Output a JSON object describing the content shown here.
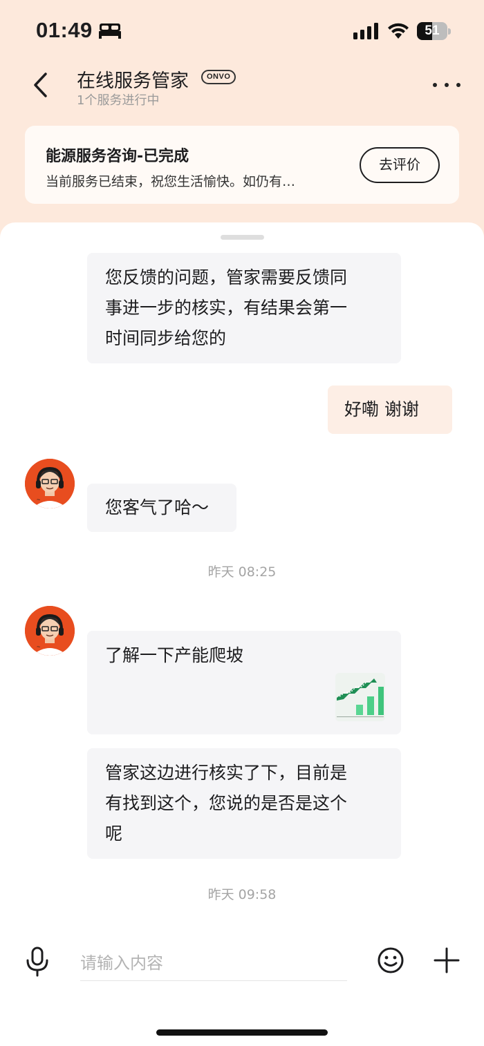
{
  "status_bar": {
    "time": "01:49",
    "battery_percent": "51",
    "battery_level": 0.51,
    "icons": [
      "bed-icon",
      "signal-icon",
      "wifi-icon",
      "battery-icon"
    ]
  },
  "header": {
    "title": "在线服务管家",
    "brand_badge": "ONVO",
    "subtitle": "1个服务进行中",
    "icons": [
      "chevron-left-icon",
      "more-icon"
    ]
  },
  "service_card": {
    "title": "能源服务咨询-已完成",
    "description": "当前服务已结束，祝您生活愉快。如仍有…",
    "review_button": "去评价"
  },
  "messages": {
    "m1": {
      "sender": "agent",
      "lines": [
        "您反馈的问题，管家需要反馈同",
        "事进一步的核实，有结果会第一",
        "时间同步给您的"
      ]
    },
    "m2": {
      "sender": "user",
      "text": "好嘞  谢谢"
    },
    "m3": {
      "sender": "agent",
      "text": "您客气了哈～"
    },
    "t1": "昨天 08:25",
    "m4": {
      "sender": "agent",
      "text": "了解一下产能爬坡",
      "has_image_thumbnail": true
    },
    "m5": {
      "sender": "agent",
      "lines": [
        "管家这边进行核实了下，目前是",
        "有找到这个，您说的是否是这个",
        "呢"
      ]
    },
    "t2": "昨天 09:58"
  },
  "input_bar": {
    "placeholder": "请输入内容",
    "icons": [
      "microphone-icon",
      "emoji-icon",
      "plus-icon"
    ]
  },
  "colors": {
    "header_bg": "#fde9dc",
    "agent_bubble": "#f5f5f7",
    "user_bubble": "#fdeee5",
    "avatar_bg": "#e84d1f"
  }
}
